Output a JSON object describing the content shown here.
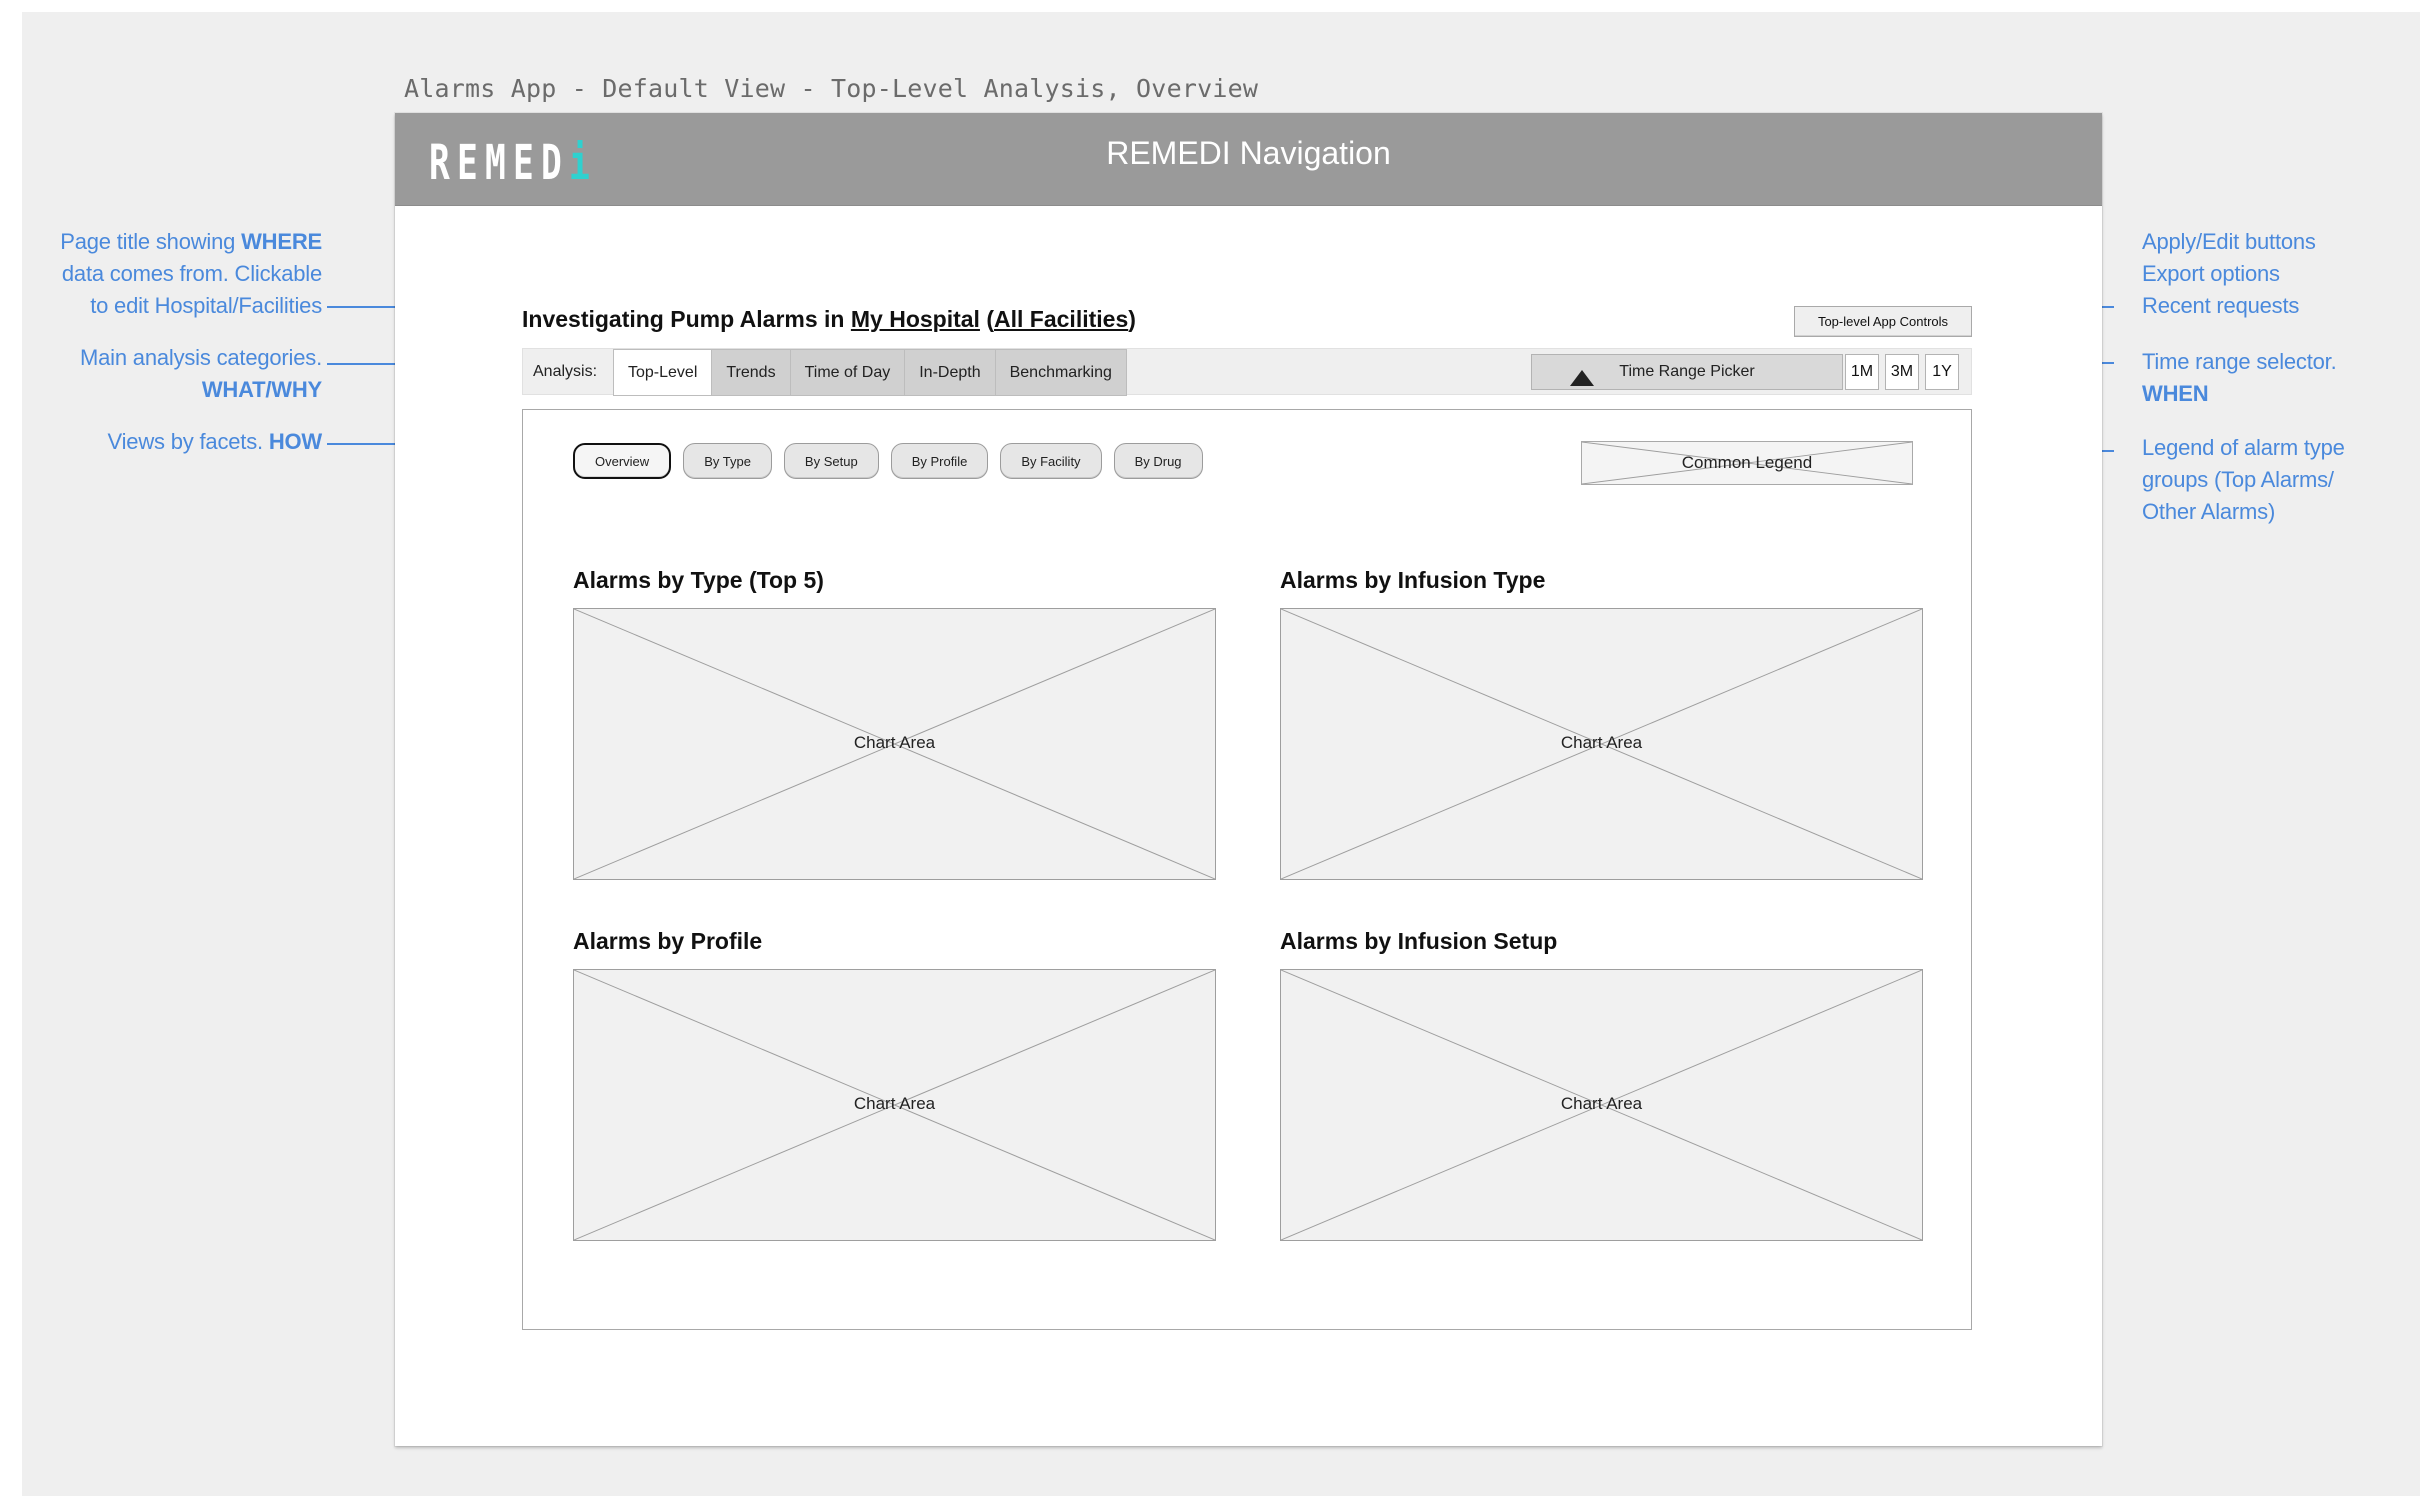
{
  "artboard": {
    "title": "Alarms App - Default View - Top-Level Analysis, Overview"
  },
  "navigation": {
    "title": "REMEDI Navigation",
    "logo": "REMEDi"
  },
  "header": {
    "prefix": "Investigating Pump Alarms in ",
    "hospital": "My Hospital",
    "open_paren": " (",
    "facilities": "All Facilities",
    "close_paren": ")"
  },
  "app_controls": {
    "label": "Top-level App Controls"
  },
  "analysis": {
    "label": "Analysis:",
    "tabs": [
      "Top-Level",
      "Trends",
      "Time of Day",
      "In-Depth",
      "Benchmarking"
    ],
    "active_tab": "Top-Level",
    "time_picker": "Time Range Picker",
    "ranges": [
      "1M",
      "3M",
      "1Y"
    ]
  },
  "facets": {
    "items": [
      "Overview",
      "By Type",
      "By Setup",
      "By Profile",
      "By Facility",
      "By Drug"
    ],
    "active": "Overview"
  },
  "legend": {
    "label": "Common Legend"
  },
  "charts": [
    {
      "title": "Alarms by Type (Top 5)",
      "placeholder": "Chart Area"
    },
    {
      "title": "Alarms by Infusion Type",
      "placeholder": "Chart Area"
    },
    {
      "title": "Alarms by Profile",
      "placeholder": "Chart Area"
    },
    {
      "title": "Alarms by Infusion Setup",
      "placeholder": "Chart Area"
    }
  ],
  "annotations": {
    "left": {
      "where": {
        "line1_prefix": "Page title showing ",
        "line1_bold": "WHERE",
        "line2": "data comes from. Clickable",
        "line3": "to edit Hospital/Facilities"
      },
      "what": {
        "line1": "Main analysis categories.",
        "line2_bold": "WHAT/WHY"
      },
      "how": {
        "line1_prefix": "Views by facets. ",
        "line1_bold": "HOW"
      }
    },
    "right": {
      "controls": {
        "line1": "Apply/Edit buttons",
        "line2": "Export options",
        "line3": "Recent requests"
      },
      "time": {
        "line1": "Time range selector.",
        "line2_bold": "WHEN"
      },
      "legend": {
        "line1": "Legend of alarm type",
        "line2": "groups (Top Alarms/",
        "line3": "Other Alarms)"
      }
    }
  },
  "colors": {
    "annotation_blue": "#4a89dc",
    "topbar_gray": "#9a9a9a",
    "logo_accent": "#2fd1cf"
  }
}
